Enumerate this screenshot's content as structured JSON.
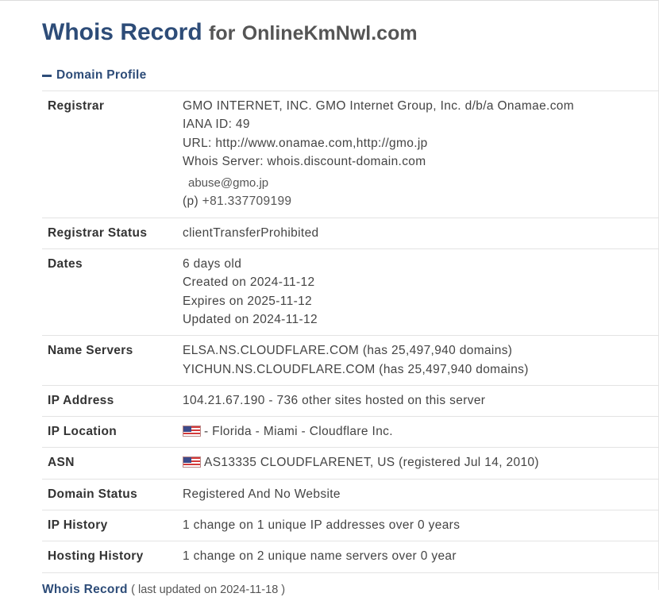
{
  "header": {
    "title_main": "Whois Record",
    "title_for": "for",
    "domain": "OnlineKmNwl.com"
  },
  "section": {
    "label": "Domain Profile"
  },
  "rows": {
    "registrar": {
      "key": "Registrar",
      "name": "GMO INTERNET, INC. GMO Internet Group, Inc. d/b/a Onamae.com",
      "iana": "IANA ID: 49",
      "url": "URL: http://www.onamae.com,http://gmo.jp",
      "whois_server": "Whois Server: whois.discount-domain.com",
      "abuse_email": "abuse@gmo.jp",
      "phone_prefix": "(p)",
      "phone": "+81.337709199"
    },
    "registrar_status": {
      "key": "Registrar Status",
      "value": "clientTransferProhibited"
    },
    "dates": {
      "key": "Dates",
      "age": "6 days old",
      "created": "Created on 2024-11-12",
      "expires": "Expires on 2025-11-12",
      "updated": "Updated on 2024-11-12"
    },
    "name_servers": {
      "key": "Name Servers",
      "ns1": "ELSA.NS.CLOUDFLARE.COM (has 25,497,940 domains)",
      "ns2": "YICHUN.NS.CLOUDFLARE.COM (has 25,497,940 domains)"
    },
    "ip_address": {
      "key": "IP Address",
      "value": "104.21.67.190 - 736 other sites hosted on this server"
    },
    "ip_location": {
      "key": "IP Location",
      "flag_icon": "us-flag-icon",
      "value": "- Florida - Miami - Cloudflare Inc."
    },
    "asn": {
      "key": "ASN",
      "flag_icon": "us-flag-icon",
      "value": "AS13335 CLOUDFLARENET, US (registered Jul 14, 2010)"
    },
    "domain_status": {
      "key": "Domain Status",
      "value": "Registered And No Website"
    },
    "ip_history": {
      "key": "IP History",
      "value": "1 change on 1 unique IP addresses over 0 years"
    },
    "hosting_history": {
      "key": "Hosting History",
      "value": "1 change on 2 unique name servers over 0 year"
    }
  },
  "footer": {
    "link": "Whois Record",
    "updated": "( last updated on 2024-11-18 )"
  },
  "colors": {
    "accent": "#2d4c78",
    "text": "#333333",
    "border": "#e3e3e3"
  }
}
